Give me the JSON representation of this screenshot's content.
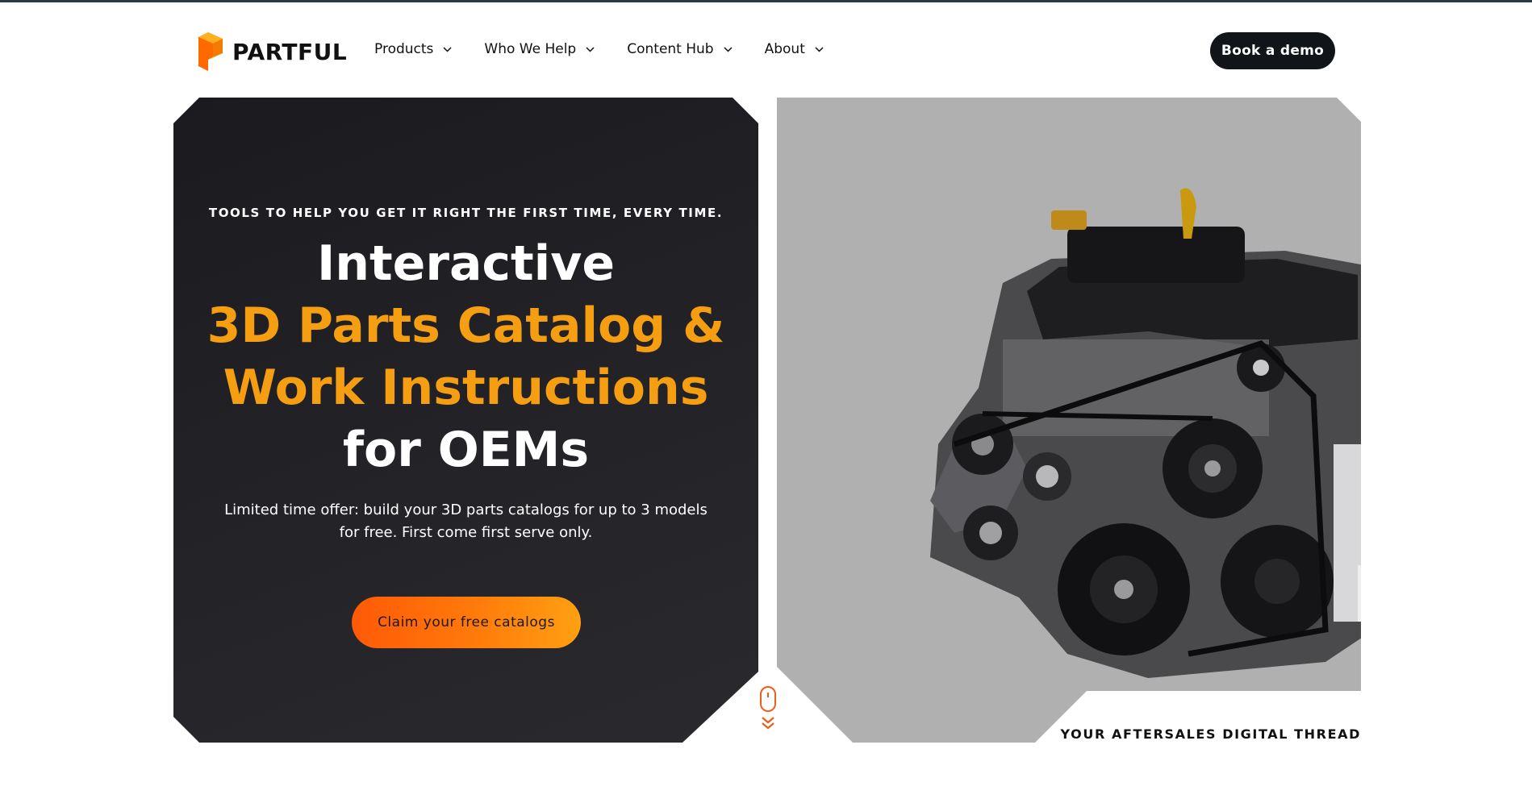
{
  "header": {
    "logo_text": "PARTFUL",
    "logo_icon": "partful-logo-icon",
    "nav": [
      {
        "label": "Products",
        "icon": "chevron-down-icon"
      },
      {
        "label": "Who We Help",
        "icon": "chevron-down-icon"
      },
      {
        "label": "Content Hub",
        "icon": "chevron-down-icon"
      },
      {
        "label": "About",
        "icon": "chevron-down-icon"
      }
    ],
    "cta_label": "Book a demo"
  },
  "hero": {
    "eyebrow": "TOOLS TO HELP YOU GET IT RIGHT THE FIRST TIME, EVERY TIME.",
    "headline_line1": "Interactive",
    "headline_line2": "3D Parts Catalog &",
    "headline_line3": "Work Instructions",
    "headline_line4": "for OEMs",
    "subtext": "Limited time offer: build your 3D parts catalogs for up to 3 models for free. First come first serve only.",
    "cta_label": "Claim your free catalogs",
    "tagline": "YOUR AFTERSALES DIGITAL THREAD",
    "scroll_icon": "scroll-down-mouse-icon"
  },
  "colors": {
    "accent_orange": "#f59e12",
    "cta_gradient_start": "#ff5a07",
    "cta_gradient_end": "#ffa012",
    "dark_card": "#1f1f23",
    "image_bg": "#b0b0b0",
    "button_dark": "#111418"
  }
}
